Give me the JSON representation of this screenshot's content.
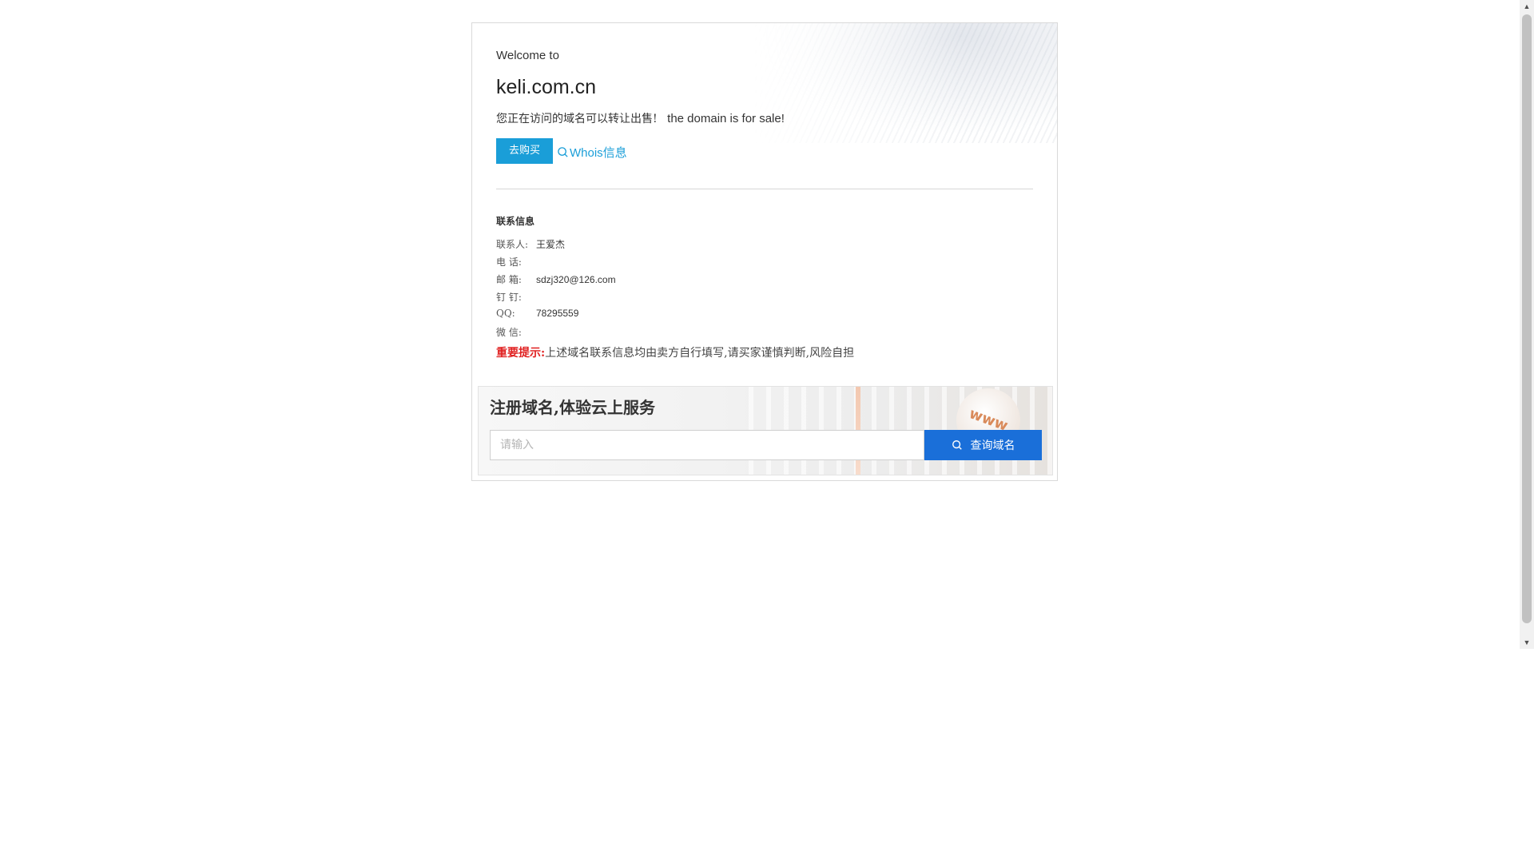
{
  "welcome": "Welcome to",
  "domain": "keli.com.cn",
  "sale_text_cn": "您正在访问的域名可以转让出售!",
  "sale_text_en": "the domain is for sale!",
  "buy_button": "去购买",
  "whois_link": "Whois信息",
  "contact": {
    "title": "联系信息",
    "rows": [
      {
        "label": "联系人:",
        "value": "王爱杰"
      },
      {
        "label": "电 话:",
        "value": ""
      },
      {
        "label": "邮 箱:",
        "value": "sdzj320@126.com"
      },
      {
        "label": "钉 钉:",
        "value": ""
      },
      {
        "label": "QQ:",
        "value": "78295559"
      },
      {
        "label": "微 信:",
        "value": ""
      }
    ]
  },
  "notice": {
    "label": "重要提示:",
    "text": "上述域名联系信息均由卖方自行填写,请买家谨慎判断,风险自担"
  },
  "promo": {
    "title": "注册域名,体验云上服务",
    "search_placeholder": "请输入",
    "search_button": "查询域名",
    "badge": "www"
  },
  "colors": {
    "accent": "#1a9ed8",
    "search_button": "#1a6fd9",
    "warning": "#e02020"
  }
}
